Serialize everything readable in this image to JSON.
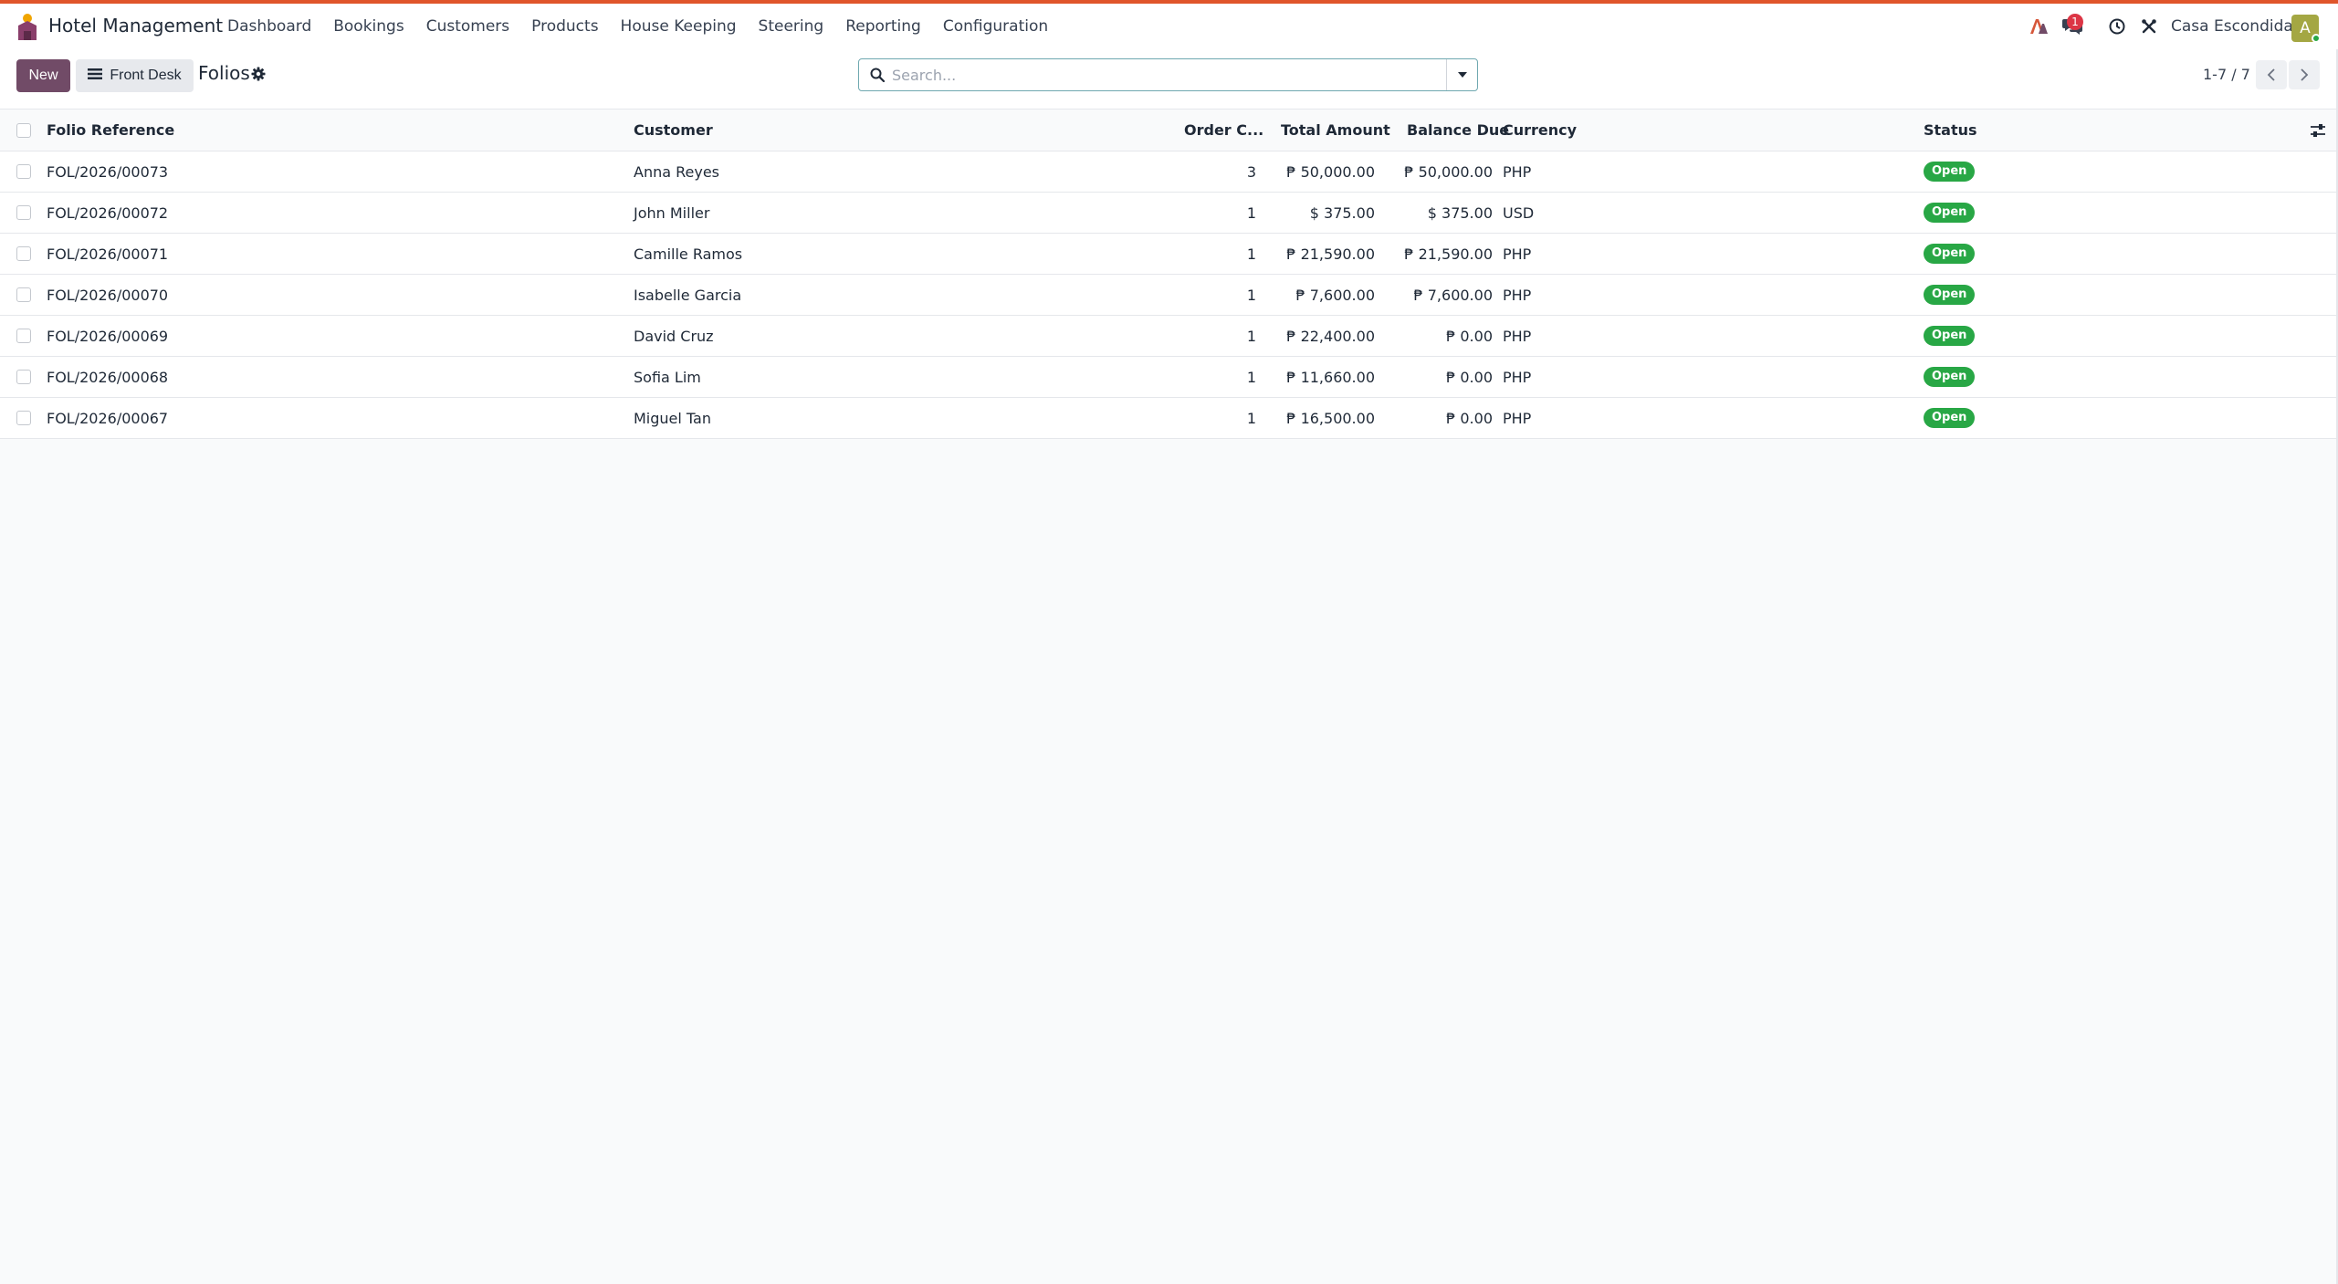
{
  "navbar": {
    "app_name": "Hotel Management",
    "menu": [
      "Dashboard",
      "Bookings",
      "Customers",
      "Products",
      "House Keeping",
      "Steering",
      "Reporting",
      "Configuration"
    ],
    "chat_badge": "1",
    "company": "Casa Escondida",
    "avatar_initial": "A",
    "colors": {
      "accent_line": "#e0552b",
      "avatar": "#a4a743",
      "badge": "#dc3545"
    }
  },
  "control": {
    "new_label": "New",
    "view_label": "Front Desk",
    "title": "Folios",
    "search_placeholder": "Search...",
    "pager": "1-7 / 7",
    "colors": {
      "primary": "#714b67",
      "search_border": "#6fa8b0"
    }
  },
  "table": {
    "headers": {
      "reference": "Folio Reference",
      "customer": "Customer",
      "order_count": "Order C...",
      "total": "Total Amount",
      "balance": "Balance Due",
      "currency": "Currency",
      "status": "Status"
    },
    "rows": [
      {
        "reference": "FOL/2026/00073",
        "customer": "Anna Reyes",
        "order_count": "3",
        "total": "₱ 50,000.00",
        "balance": "₱ 50,000.00",
        "currency": "PHP",
        "status": "Open"
      },
      {
        "reference": "FOL/2026/00072",
        "customer": "John Miller",
        "order_count": "1",
        "total": "$ 375.00",
        "balance": "$ 375.00",
        "currency": "USD",
        "status": "Open"
      },
      {
        "reference": "FOL/2026/00071",
        "customer": "Camille Ramos",
        "order_count": "1",
        "total": "₱ 21,590.00",
        "balance": "₱ 21,590.00",
        "currency": "PHP",
        "status": "Open"
      },
      {
        "reference": "FOL/2026/00070",
        "customer": "Isabelle Garcia",
        "order_count": "1",
        "total": "₱ 7,600.00",
        "balance": "₱ 7,600.00",
        "currency": "PHP",
        "status": "Open"
      },
      {
        "reference": "FOL/2026/00069",
        "customer": "David Cruz",
        "order_count": "1",
        "total": "₱ 22,400.00",
        "balance": "₱ 0.00",
        "currency": "PHP",
        "status": "Open"
      },
      {
        "reference": "FOL/2026/00068",
        "customer": "Sofia Lim",
        "order_count": "1",
        "total": "₱ 11,660.00",
        "balance": "₱ 0.00",
        "currency": "PHP",
        "status": "Open"
      },
      {
        "reference": "FOL/2026/00067",
        "customer": "Miguel Tan",
        "order_count": "1",
        "total": "₱ 16,500.00",
        "balance": "₱ 0.00",
        "currency": "PHP",
        "status": "Open"
      }
    ],
    "colors": {
      "status_open": "#28a745"
    }
  }
}
